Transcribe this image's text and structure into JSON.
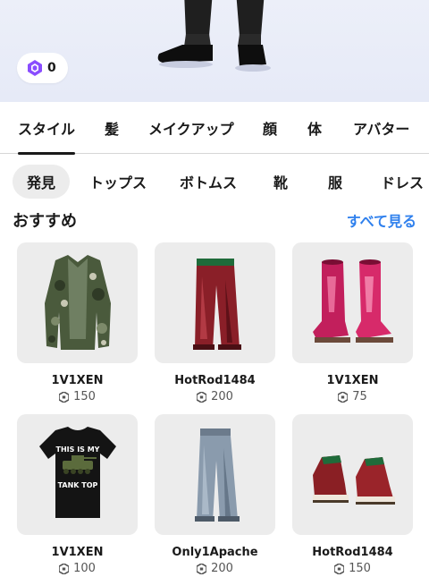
{
  "balance": {
    "icon": "robux-gem-icon",
    "value": "0"
  },
  "tabs": [
    {
      "label": "スタイル",
      "active": true
    },
    {
      "label": "髪",
      "active": false
    },
    {
      "label": "メイクアップ",
      "active": false
    },
    {
      "label": "顔",
      "active": false
    },
    {
      "label": "体",
      "active": false
    },
    {
      "label": "アバター",
      "active": false
    }
  ],
  "chips": [
    {
      "label": "発見",
      "active": true
    },
    {
      "label": "トップス",
      "active": false
    },
    {
      "label": "ボトムス",
      "active": false
    },
    {
      "label": "靴",
      "active": false
    },
    {
      "label": "服",
      "active": false
    },
    {
      "label": "ドレス",
      "active": false
    }
  ],
  "section": {
    "title": "おすすめ",
    "see_all": "すべて見る"
  },
  "items": [
    {
      "creator": "1V1XEN",
      "price": "150",
      "image": "camo-jacket"
    },
    {
      "creator": "HotRod1484",
      "price": "200",
      "image": "red-pants"
    },
    {
      "creator": "1V1XEN",
      "price": "75",
      "image": "pink-boots"
    },
    {
      "creator": "1V1XEN",
      "price": "100",
      "image": "tank-top-shirt",
      "shirt_text": [
        "THIS IS MY",
        "TANK TOP"
      ]
    },
    {
      "creator": "Only1Apache",
      "price": "200",
      "image": "blue-jeans"
    },
    {
      "creator": "HotRod1484",
      "price": "150",
      "image": "red-sneakers"
    }
  ],
  "colors": {
    "accent": "#2f80ed",
    "gem": "#8a4dff",
    "tab_active": "#1a1a1a"
  }
}
